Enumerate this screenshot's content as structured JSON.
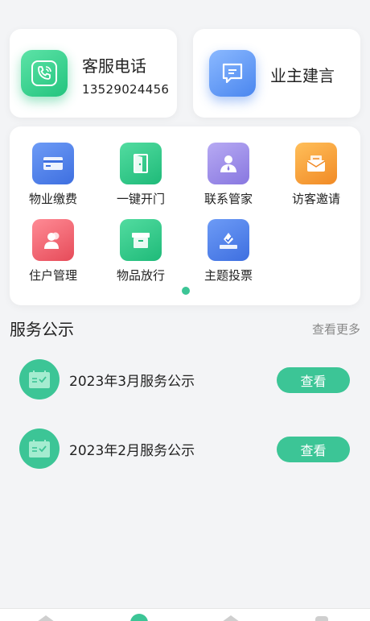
{
  "service_phone": {
    "title": "客服电话",
    "number": "13529024456",
    "icon": "phone-icon"
  },
  "owner_advice": {
    "title": "业主建言",
    "icon": "chat-message-icon"
  },
  "grid": {
    "items": [
      {
        "label": "物业缴费",
        "icon": "card-payment-icon",
        "color": "#4a7fe8"
      },
      {
        "label": "一键开门",
        "icon": "door-icon",
        "color": "#2cc486"
      },
      {
        "label": "联系管家",
        "icon": "person-icon",
        "color": "#9d8ee8"
      },
      {
        "label": "访客邀请",
        "icon": "envelope-icon",
        "color": "#f5a038"
      },
      {
        "label": "住户管理",
        "icon": "users-icon",
        "color": "#ee5e6a"
      },
      {
        "label": "物品放行",
        "icon": "box-icon",
        "color": "#2cc486"
      },
      {
        "label": "主题投票",
        "icon": "vote-icon",
        "color": "#4a7fe8"
      }
    ],
    "page_indicator": {
      "current": 1,
      "total": 1
    }
  },
  "notices": {
    "title": "服务公示",
    "more_label": "查看更多",
    "items": [
      {
        "title": "2023年3月服务公示",
        "button": "查看",
        "icon": "notice-board-icon"
      },
      {
        "title": "2023年2月服务公示",
        "button": "查看",
        "icon": "notice-board-icon"
      }
    ]
  },
  "colors": {
    "accent": "#3cc596",
    "background": "#f3f4f6"
  }
}
